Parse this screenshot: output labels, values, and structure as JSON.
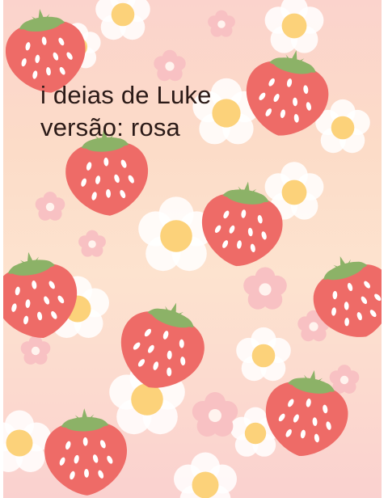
{
  "caption": {
    "line1": "i deias de Luke",
    "line2": "versão: rosa"
  },
  "colors": {
    "background_top": "#fbd3cc",
    "background_bottom": "#fad1cf",
    "strawberry": "#ee6b67",
    "strawberry_leaf": "#8cb267",
    "seed": "#ffffff",
    "flower_yellow": "#fcd27a",
    "flower_white": "#ffffff",
    "flower_pink": "#f8c1c3",
    "text": "#2b1a17"
  },
  "icons": [
    "strawberry-icon",
    "flower-icon"
  ]
}
